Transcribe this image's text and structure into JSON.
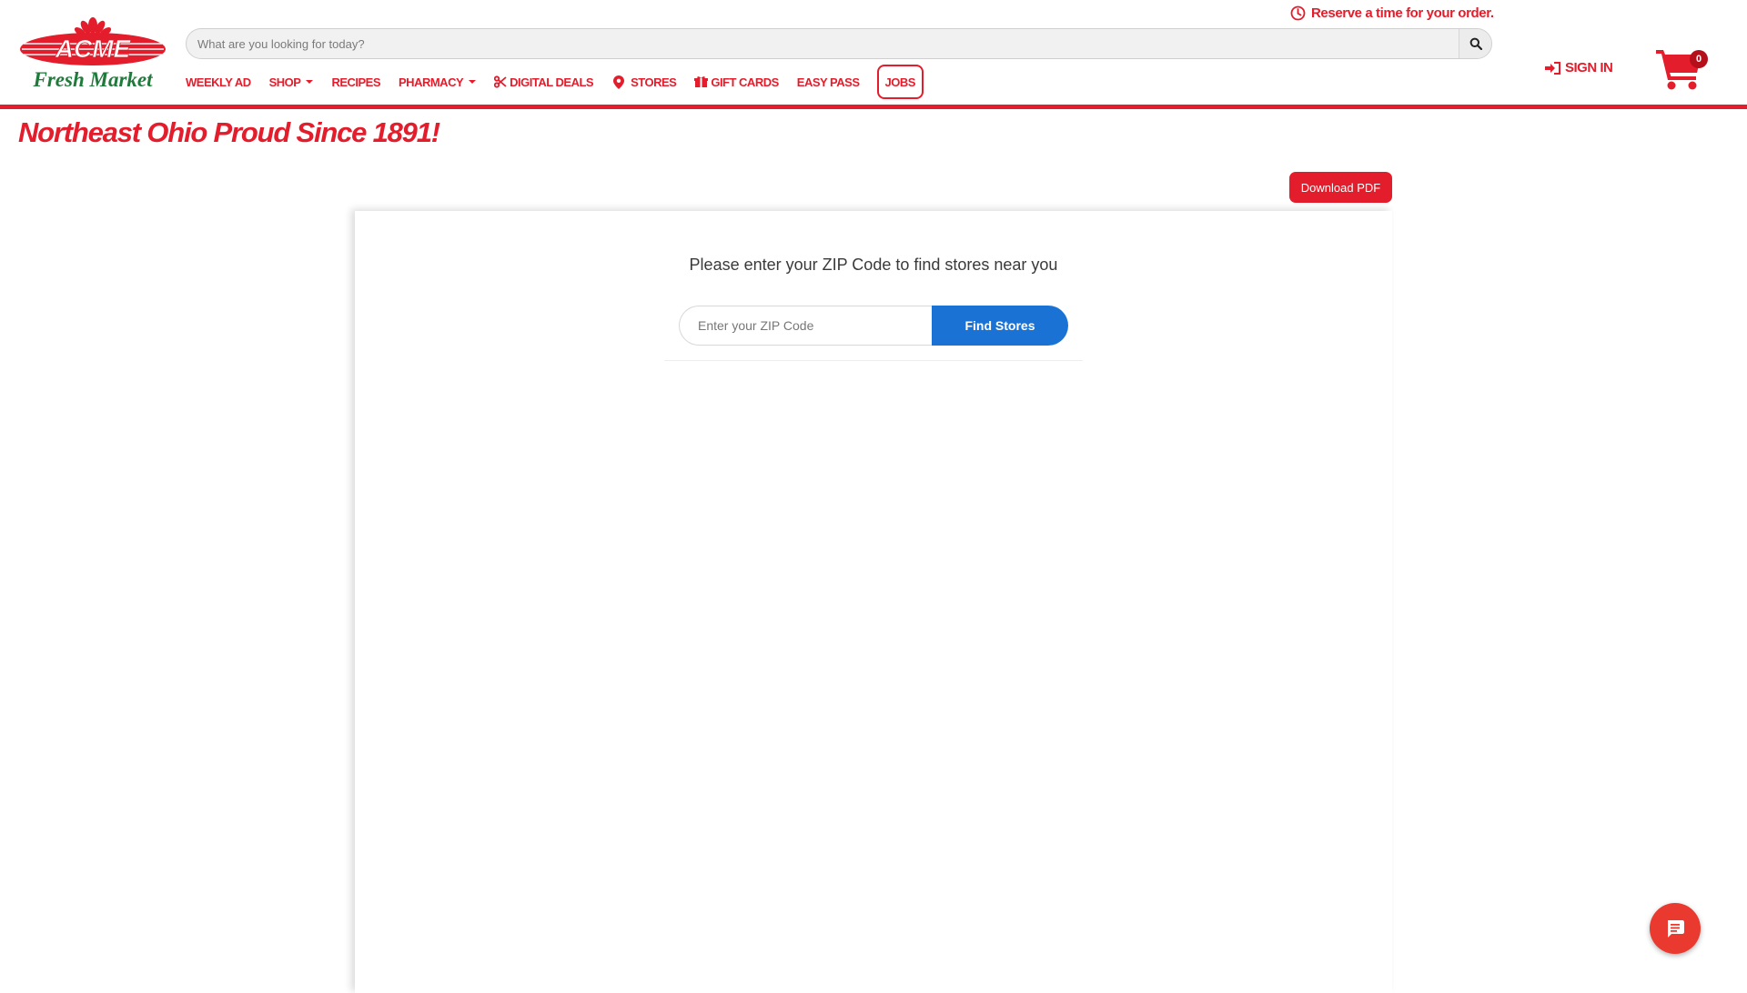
{
  "brand": {
    "logo_text_top": "ACME",
    "logo_text_bottom": "Fresh Market",
    "accent_color": "#e31d2b",
    "logo_green": "#1f7a3b"
  },
  "header": {
    "search_placeholder": "What are you looking for today?",
    "search_icon": "search-icon",
    "reserve_label": "Reserve a time for your order.",
    "reserve_icon": "clock-icon",
    "signin_label": "SIGN IN",
    "signin_icon": "sign-in-icon",
    "cart_icon": "shopping-cart-icon",
    "cart_count": "0"
  },
  "nav": {
    "weekly_ad": "WEEKLY AD",
    "shop": "SHOP",
    "recipes": "RECIPES",
    "pharmacy": "PHARMACY",
    "digital_deals": "DIGITAL DEALS",
    "stores": "STORES",
    "gift_cards": "GIFT CARDS",
    "easy_pass": "EASY PASS",
    "jobs": "JOBS"
  },
  "page": {
    "tagline": "Northeast Ohio Proud Since 1891!",
    "download_label": "Download PDF"
  },
  "store_finder": {
    "prompt": "Please enter your ZIP Code to find stores near you",
    "zip_placeholder": "Enter your ZIP Code",
    "find_label": "Find Stores",
    "button_color": "#1a73d4"
  },
  "chat": {
    "icon": "chat-icon",
    "color": "#ea3a2f"
  }
}
